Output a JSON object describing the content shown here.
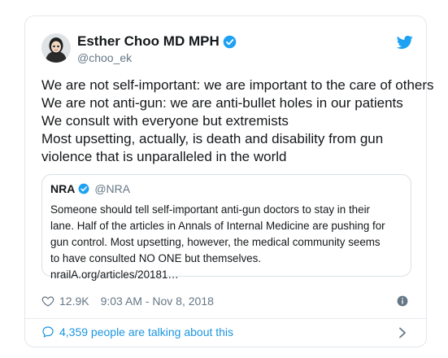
{
  "author": {
    "display_name": "Esther Choo MD MPH",
    "handle": "@choo_ek"
  },
  "tweet": {
    "lines": [
      "We are not self-important: we are important to the care of others",
      "We are not anti-gun: we are anti-bullet holes in our patients",
      "We consult with everyone but extremists",
      "Most upsetting, actually, is death and disability from gun",
      "violence that is unparalleled in the world"
    ]
  },
  "quoted": {
    "display_name": "NRA",
    "handle": "@NRA",
    "lines": [
      "Someone should tell self-important  anti-gun doctors to stay in their",
      "lane. Half of the articles in Annals of Internal Medicine are pushing for",
      "gun control. Most upsetting, however, the medical community seems",
      "to have consulted NO ONE but themselves.",
      "nrailA.org/articles/20181…"
    ]
  },
  "meta": {
    "likes": "12.9K",
    "timestamp": "9:03 AM - Nov 8, 2018"
  },
  "footer": {
    "talking_text": "4,359 people are talking about this"
  },
  "colors": {
    "verified": "#1da1f2",
    "link": "#1b95e0",
    "secondary_text": "#657786"
  },
  "icons": {
    "verified": "verified-badge-icon",
    "brand": "twitter-bird-icon",
    "like": "heart-icon",
    "info": "info-icon",
    "talking": "speech-bubble-icon",
    "more": "chevron-right-icon"
  }
}
